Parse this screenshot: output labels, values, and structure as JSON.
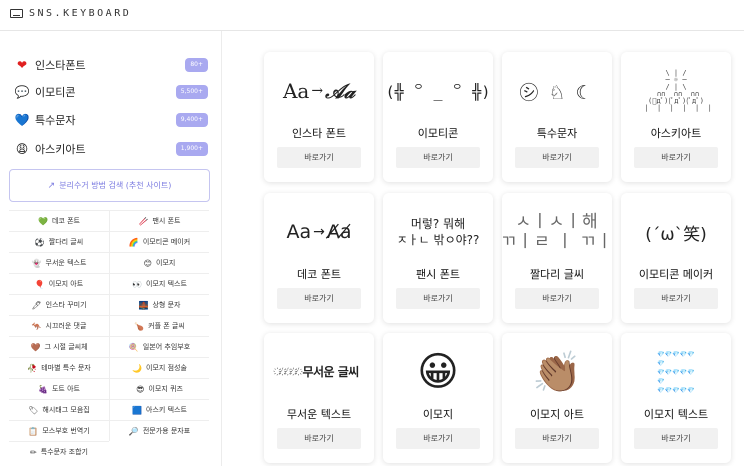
{
  "header": {
    "logo_text": "SNS.KEYBOARD"
  },
  "sidebar": {
    "categories": [
      {
        "icon": "❤",
        "icon_name": "heart-icon",
        "label": "인스타폰트",
        "badge": "80+",
        "icon_color": "#e02020"
      },
      {
        "icon": "💬",
        "icon_name": "speech-bubble-icon",
        "label": "이모티콘",
        "badge": "5,500+",
        "icon_color": "#333333"
      },
      {
        "icon": "💙",
        "icon_name": "blue-heart-icon",
        "label": "특수문자",
        "badge": "9,400+",
        "icon_color": "#1e7be0"
      },
      {
        "icon": "😩",
        "icon_name": "face-icon",
        "label": "아스키아트",
        "badge": "1,900+",
        "icon_color": "#e0a020"
      }
    ],
    "guide_label": "분리수거 방법 검색 (추천 사이트)",
    "grid": [
      {
        "icon": "💚",
        "label": "데코 폰트"
      },
      {
        "icon": "🥢",
        "label": "팬시 폰트"
      },
      {
        "icon": "⚽",
        "label": "짤다리 글씨"
      },
      {
        "icon": "🌈",
        "label": "이모티콘 메이커"
      },
      {
        "icon": "👻",
        "label": "무서운 텍스트"
      },
      {
        "icon": "😊",
        "label": "이모지"
      },
      {
        "icon": "🎈",
        "label": "이모지 아트"
      },
      {
        "icon": "👀",
        "label": "이모지 텍스트"
      },
      {
        "icon": "🖊",
        "label": "인스타 꾸미기"
      },
      {
        "icon": "🌉",
        "label": "상형 문자"
      },
      {
        "icon": "🦘",
        "label": "시끄러운 댓글"
      },
      {
        "icon": "🍗",
        "label": "커플 폰 글씨"
      },
      {
        "icon": "🤎",
        "label": "그 시절 글씨체"
      },
      {
        "icon": "🍭",
        "label": "일본어 추임부호"
      },
      {
        "icon": "🥀",
        "label": "테마별 특수 문자"
      },
      {
        "icon": "🌙",
        "label": "이모지 점성술"
      },
      {
        "icon": "🍇",
        "label": "도트 아트"
      },
      {
        "icon": "😎",
        "label": "이모지 퀴즈"
      },
      {
        "icon": "🏷",
        "label": "해시태그 모음집"
      },
      {
        "icon": "🟦",
        "label": "아스키 텍스트"
      },
      {
        "icon": "📋",
        "label": "모스부호 번역기"
      },
      {
        "icon": "🔎",
        "label": "전문가용 문자표"
      },
      {
        "icon": "✏",
        "label": "특수문자 조합기"
      }
    ]
  },
  "cards": [
    {
      "title": "인스타 폰트",
      "button": "바로가기",
      "art": {
        "left": "Aa",
        "arrow": "→",
        "right": "𝒜𝒶"
      }
    },
    {
      "title": "이모티콘",
      "button": "바로가기",
      "art": "(╬ ꒪ _ ꒪ ╬)"
    },
    {
      "title": "특수문자",
      "button": "바로가기",
      "art": "㋛ ♘ ☾"
    },
    {
      "title": "아스키아트",
      "button": "바로가기",
      "art": "   \\ | /   \n  ─ ☼ ─  \n   / | \\   \n ∩∩  ∩∩  ∩∩\n(ﾟдﾟ)(ﾟдﾟ)(ﾟдﾟ)\n |  |  |  |  |  |"
    },
    {
      "title": "데코 폰트",
      "button": "바로가기",
      "art": {
        "left": "Aa",
        "arrow": "→",
        "right": "A̸a̸"
      }
    },
    {
      "title": "팬시 폰트",
      "button": "바로가기",
      "art": "머렇? 뭐해\nㅈㅏㄴ 밖ㅇ야??"
    },
    {
      "title": "짤다리 글씨",
      "button": "바로가기",
      "art": "ㅅㅣㅅㅣ해\nㄲㅣㄹ ㅣ ㄲㅣ"
    },
    {
      "title": "이모티콘 메이커",
      "button": "바로가기",
      "art": "(´ω`笑)"
    },
    {
      "title": "무서운 텍스트",
      "button": "바로가기",
      "art": "무서운 글씨"
    },
    {
      "title": "이모지",
      "button": "바로가기",
      "art": "😀"
    },
    {
      "title": "이모지 아트",
      "button": "바로가기",
      "art": "👏🏽"
    },
    {
      "title": "이모지 텍스트",
      "button": "바로가기",
      "art": "💎💎💎💎💎\n💎\n💎💎💎💎💎\n💎\n💎💎💎💎💎"
    }
  ],
  "colors": {
    "badge": "#a9a9f0",
    "guide_border": "#c5c5f0",
    "guide_text": "#7b7be0",
    "button_bg": "#f1f1f1"
  }
}
